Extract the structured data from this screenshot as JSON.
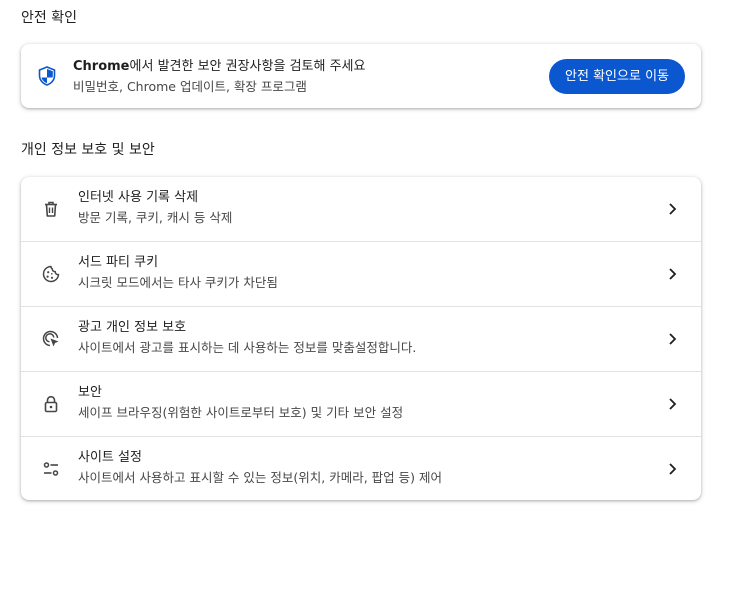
{
  "safety_check": {
    "section_title": "안전 확인",
    "card": {
      "title_brand": "Chrome",
      "title_rest": "에서 발견한 보안 권장사항을 검토해 주세요",
      "subtitle": "비밀번호, Chrome 업데이트, 확장 프로그램",
      "button_label": "안전 확인으로 이동",
      "icon": "shield-icon"
    }
  },
  "privacy": {
    "section_title": "개인 정보 보호 및 보안",
    "items": [
      {
        "title": "인터넷 사용 기록 삭제",
        "subtitle": "방문 기록, 쿠키, 캐시 등 삭제",
        "icon": "trash-icon"
      },
      {
        "title": "서드 파티 쿠키",
        "subtitle": "시크릿 모드에서는 타사 쿠키가 차단됨",
        "icon": "cookie-icon"
      },
      {
        "title": "광고 개인 정보 보호",
        "subtitle": "사이트에서 광고를 표시하는 데 사용하는 정보를 맞춤설정합니다.",
        "icon": "ad-privacy-icon"
      },
      {
        "title": "보안",
        "subtitle": "세이프 브라우징(위험한 사이트로부터 보호) 및 기타 보안 설정",
        "icon": "lock-icon"
      },
      {
        "title": "사이트 설정",
        "subtitle": "사이트에서 사용하고 표시할 수 있는 정보(위치, 카메라, 팝업 등) 제어",
        "icon": "sliders-icon"
      }
    ]
  },
  "colors": {
    "accent": "#0b57d0",
    "text_primary": "#1f1f1f",
    "text_secondary": "#474747",
    "icon": "#444746",
    "divider": "#e3e3e3"
  }
}
